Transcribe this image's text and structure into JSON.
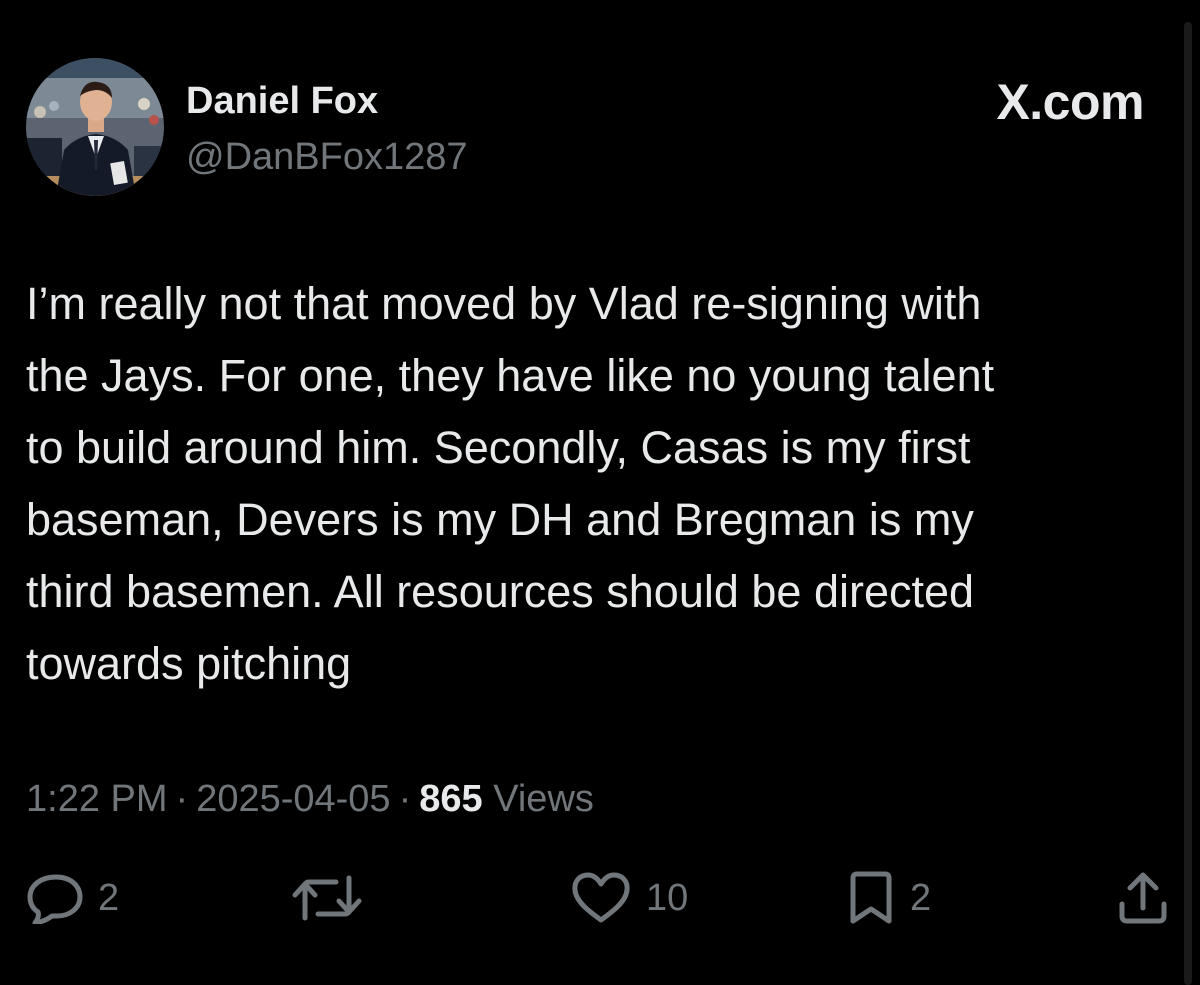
{
  "author": {
    "display_name": "Daniel Fox",
    "handle": "@DanBFox1287"
  },
  "site": {
    "brand": "X.com"
  },
  "tweet": {
    "text": "I’m really not that moved by Vlad re-signing with\nthe Jays. For one, they have like no young talent\nto build around him. Secondly, Casas is my first\nbaseman, Devers is my DH and Bregman is my\nthird basemen. All resources should be directed\ntowards pitching",
    "time": "1:22 PM",
    "date": "2025-04-05",
    "separator": "·",
    "views_count": "865",
    "views_label": "Views"
  },
  "actions": {
    "reply_count": "2",
    "like_count": "10",
    "bookmark_count": "2"
  },
  "icons": {
    "reply": "comment-bubble-icon",
    "repost": "repost-arrows-icon",
    "like": "heart-icon",
    "bookmark": "bookmark-icon",
    "share": "share-upload-icon"
  },
  "colors": {
    "background": "#000000",
    "primary_text": "#e7e9ea",
    "secondary_text": "#71767b"
  }
}
